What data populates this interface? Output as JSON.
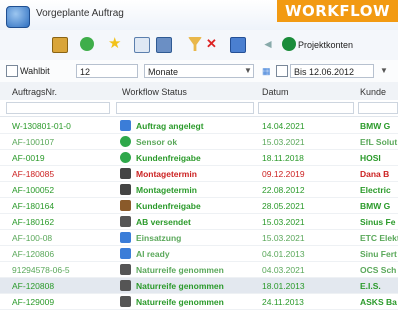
{
  "window": {
    "title": "Vorgeplante Auftrag"
  },
  "badge": {
    "label": "WORKFLOW",
    "color": "#f29a12"
  },
  "toolbar": {
    "icons": [
      "clipboard-icon",
      "refresh-icon",
      "star-icon",
      "document-icon",
      "grid-icon",
      "filter-icon",
      "delete-filter-icon",
      "chart-icon",
      "back-icon",
      "forward-icon"
    ],
    "last_label": "Projektkonten"
  },
  "filter": {
    "checkbox_label": "Wahlbit",
    "value": "12",
    "unit": "Monate",
    "date_label": "Bis 12.06.2012"
  },
  "columns": {
    "order": "AuftragsNr.",
    "status": "Workflow Status",
    "date": "Datum",
    "customer": "Kunde"
  },
  "rows": [
    {
      "order": "W-130801-01-0",
      "status": "Auftrag angelegt",
      "date": "14.04.2021",
      "customer": "BMW G",
      "color": "#2a9a2a",
      "icon": "document-icon",
      "icon_color": "#3b7dd8"
    },
    {
      "order": "AF-100107",
      "status": "Sensor ok",
      "date": "15.03.2021",
      "customer": "EfL Solut",
      "color": "#5aa85a",
      "icon": "check-icon",
      "icon_color": "#2ea84a"
    },
    {
      "order": "AF-0019",
      "status": "Kundenfreigabe",
      "date": "18.11.2018",
      "customer": "HOSI",
      "color": "#2a9a2a",
      "icon": "check-icon",
      "icon_color": "#2ea84a"
    },
    {
      "order": "AF-180085",
      "status": "Montagetermin",
      "date": "09.12.2019",
      "customer": "Dana B",
      "color": "#cc2222",
      "icon": "printer-icon",
      "icon_color": "#444"
    },
    {
      "order": "AF-100052",
      "status": "Montagetermin",
      "date": "22.08.2012",
      "customer": "Electric",
      "color": "#2a9a2a",
      "icon": "printer-icon",
      "icon_color": "#444"
    },
    {
      "order": "AF-180164",
      "status": "Kundenfreigabe",
      "date": "28.05.2021",
      "customer": "BMW G",
      "color": "#2a9a2a",
      "icon": "person-icon",
      "icon_color": "#8a5a2a"
    },
    {
      "order": "AF-180162",
      "status": "AB versendet",
      "date": "15.03.2021",
      "customer": "Sinus Fe",
      "color": "#2a9a2a",
      "icon": "mail-icon",
      "icon_color": "#555"
    },
    {
      "order": "AF-100-08",
      "status": "Einsatzung",
      "date": "15.03.2021",
      "customer": "ETC Elekt",
      "color": "#5aa85a",
      "icon": "chart-icon",
      "icon_color": "#3b7dd8"
    },
    {
      "order": "AF-120806",
      "status": "AI ready",
      "date": "04.01.2013",
      "customer": "Sinu Fert",
      "color": "#5aa85a",
      "icon": "chart-icon",
      "icon_color": "#3b7dd8"
    },
    {
      "order": "91294578-06-5",
      "status": "Naturreife genommen",
      "date": "04.03.2021",
      "customer": "OCS Sch",
      "color": "#5aa85a",
      "icon": "car-icon",
      "icon_color": "#555"
    },
    {
      "order": "AF-120808",
      "status": "Naturreife genommen",
      "date": "18.01.2013",
      "customer": "E.I.S.",
      "color": "#2a9a2a",
      "icon": "car-icon",
      "icon_color": "#555",
      "selected": true
    },
    {
      "order": "AF-129009",
      "status": "Naturreife genommen",
      "date": "24.11.2013",
      "customer": "ASKS Ba",
      "color": "#2a9a2a",
      "icon": "car-icon",
      "icon_color": "#555"
    }
  ]
}
